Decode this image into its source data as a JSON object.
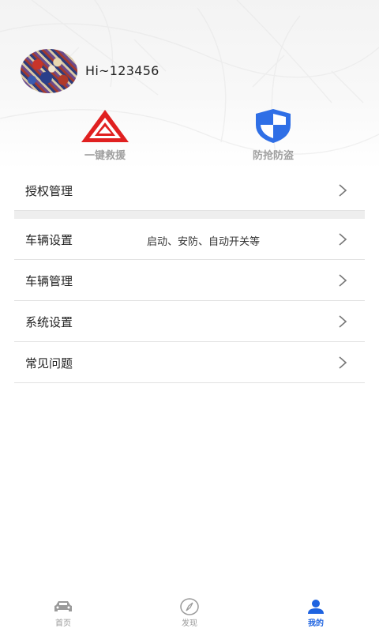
{
  "profile": {
    "greeting": "Hi~123456"
  },
  "quick_actions": [
    {
      "label": "一键救援",
      "icon": "warning-triangle-icon",
      "color": "#e02020"
    },
    {
      "label": "防抢防盗",
      "icon": "shield-icon",
      "color": "#2f6fe6"
    }
  ],
  "menu": {
    "authorization": {
      "label": "授权管理"
    },
    "items": [
      {
        "label": "车辆设置",
        "sub": "启动、安防、自动开关等"
      },
      {
        "label": "车辆管理",
        "sub": ""
      },
      {
        "label": "系统设置",
        "sub": ""
      },
      {
        "label": "常见问题",
        "sub": ""
      }
    ]
  },
  "tabbar": {
    "tabs": [
      {
        "label": "首页",
        "icon": "car-icon",
        "active": false
      },
      {
        "label": "发现",
        "icon": "compass-icon",
        "active": false
      },
      {
        "label": "我的",
        "icon": "user-icon",
        "active": true
      }
    ],
    "active_color": "#1e63e0",
    "inactive_color": "#9a9a9a"
  }
}
